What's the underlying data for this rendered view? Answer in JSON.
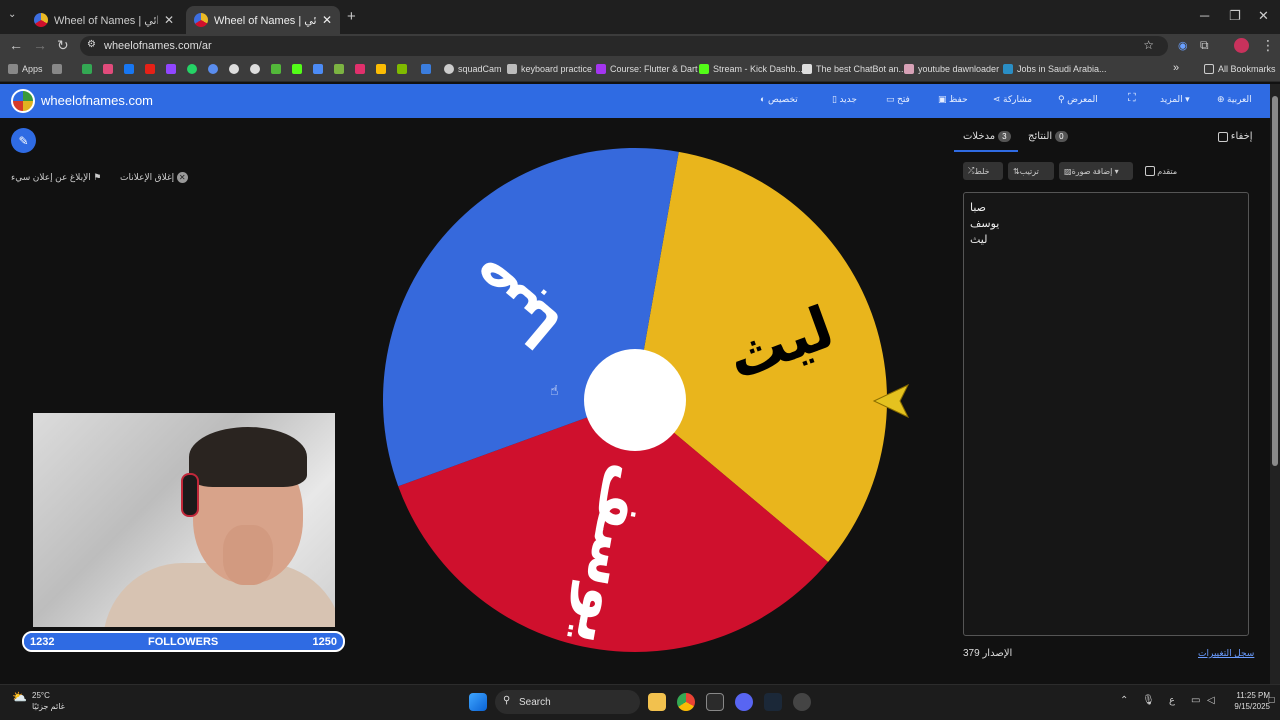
{
  "browser": {
    "tabs": [
      {
        "title": "Wheel of Names | سم العشوائي",
        "active": false
      },
      {
        "title": "Wheel of Names | سم العشوائي",
        "active": true
      }
    ],
    "new_tab": "+",
    "close_glyph": "✕",
    "url": "wheelofnames.com/ar",
    "window_controls": {
      "minimize": "─",
      "maximize": "❐",
      "close": "✕"
    },
    "bookmarks": [
      {
        "label": "Apps"
      },
      {
        "label": "squadCam"
      },
      {
        "label": "keyboard practice"
      },
      {
        "label": "Course: Flutter & Dart"
      },
      {
        "label": "Stream - Kick Dashb..."
      },
      {
        "label": "The best ChatBot an..."
      },
      {
        "label": "youtube dawnloader"
      },
      {
        "label": "Jobs in Saudi Arabia..."
      }
    ],
    "bookmarks_more": "»",
    "all_bookmarks": "All Bookmarks"
  },
  "site": {
    "logo_text": "wheelofnames.com",
    "nav": [
      {
        "label": "تخصيص",
        "icon": "palette-icon"
      },
      {
        "label": "جديد",
        "icon": "new-file-icon"
      },
      {
        "label": "فتح",
        "icon": "folder-icon"
      },
      {
        "label": "حفظ",
        "icon": "save-icon"
      },
      {
        "label": "مشاركة",
        "icon": "share-icon"
      },
      {
        "label": "المعرض",
        "icon": "search-icon"
      },
      {
        "label": "",
        "icon": "fullscreen-icon"
      },
      {
        "label": "المزيد",
        "icon": "dropdown-icon"
      },
      {
        "label": "العربية",
        "icon": "globe-icon"
      }
    ]
  },
  "left": {
    "report_ad": "الإبلاغ عن إعلان سيء",
    "close_ads": "إغلاق الإعلانات"
  },
  "overlay": {
    "followers_label": "FOLLOWERS",
    "followers_current": "1232",
    "followers_goal": "1250",
    "progress": 0.9856
  },
  "wheel": {
    "segments": [
      {
        "label": "ليث",
        "color": "#e9b51c"
      },
      {
        "label": "يوسف",
        "color": "#cf102d"
      },
      {
        "label": "صبا",
        "color": "#3669dc"
      }
    ],
    "pointer_color": "#e4c21f"
  },
  "right": {
    "hide_label": "إخفاء",
    "results_label": "النتائج",
    "results_count": "0",
    "entries_label": "مدخلات",
    "entries_count": "3",
    "shuffle_label": "خلط",
    "sort_label": "ترتيب",
    "add_image_label": "إضافة صورة",
    "advanced_label": "متقدم",
    "entries": [
      "صبا",
      "يوسف",
      "ليث"
    ],
    "version_label": "الإصدار",
    "version_number": "379",
    "changelog_label": "سجل التغييرات"
  },
  "taskbar": {
    "weather_temp": "25°C",
    "weather_desc": "غائم جزئيًا",
    "search_label": "Search",
    "time": "11:25 PM",
    "date": "9/15/2025",
    "lang": "ع"
  }
}
